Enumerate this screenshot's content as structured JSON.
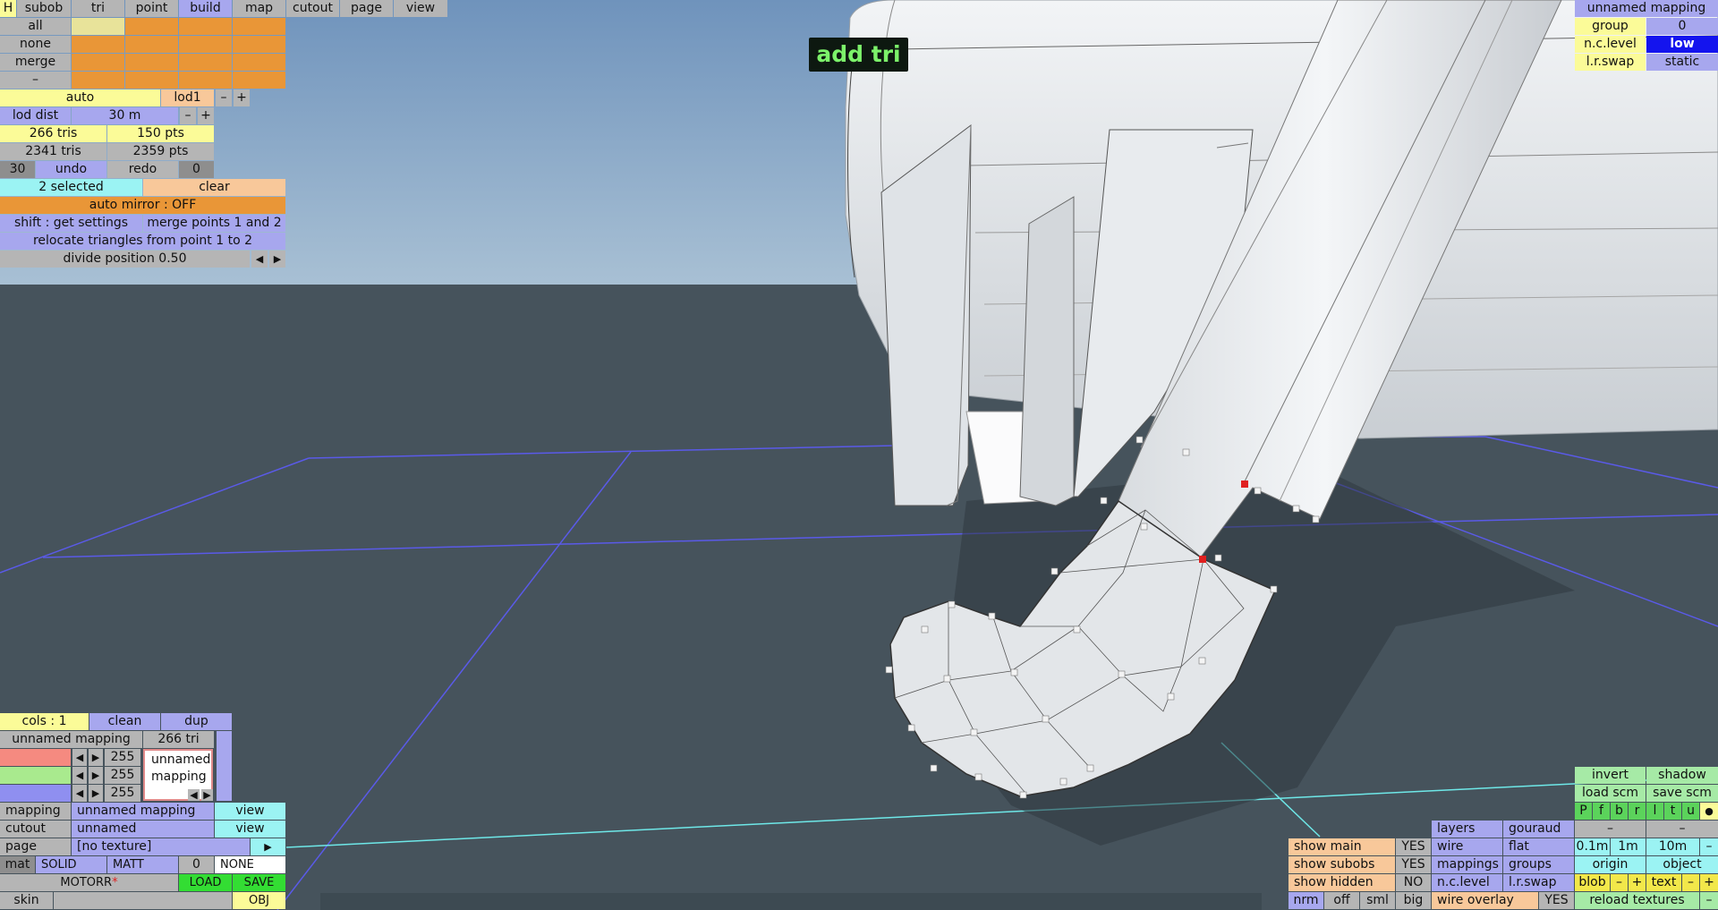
{
  "menu": {
    "h": "H",
    "tabs": [
      "subob",
      "tri",
      "point",
      "build",
      "map",
      "cutout",
      "page",
      "view"
    ],
    "active": "build"
  },
  "subob": {
    "all": "all",
    "none": "none",
    "merge": "merge",
    "minus": "–"
  },
  "lod": {
    "auto": "auto",
    "lod": "lod1",
    "minus": "–",
    "plus": "+",
    "dist_label": "lod dist",
    "dist_value": "30 m",
    "tris": "266 tris",
    "pts": "150 pts",
    "total_tris": "2341 tris",
    "total_pts": "2359 pts"
  },
  "history": {
    "count": "30",
    "undo": "undo",
    "redo": "redo",
    "redo_count": "0"
  },
  "selection": {
    "selected": "2 selected",
    "clear": "clear"
  },
  "build": {
    "auto_mirror": "auto mirror : OFF",
    "shift_settings": "shift : get settings",
    "merge_points": "merge points 1 and 2",
    "relocate": "relocate triangles from point 1 to 2",
    "divide": "divide position 0.50",
    "prev": "◀",
    "next": "▶"
  },
  "hint": "add tri",
  "mapping_panel": {
    "title": "unnamed mapping",
    "group_label": "group",
    "group_value": "0",
    "nclevel_label": "n.c.level",
    "nclevel_value": "low",
    "lrswap_label": "l.r.swap",
    "lrswap_value": "static"
  },
  "color_panel": {
    "cols": "cols : 1",
    "clean": "clean",
    "dup": "dup",
    "mapping": "unnamed mapping",
    "tri": "266 tri",
    "r": "255",
    "g": "255",
    "b": "255",
    "preview": "unnamed mapping",
    "left": "◀",
    "right": "▶"
  },
  "material": {
    "mapping_label": "mapping",
    "mapping_value": "unnamed mapping",
    "view": "view",
    "cutout_label": "cutout",
    "cutout_value": "unnamed",
    "page_label": "page",
    "page_value": "[no texture]",
    "page_arrow": "▶",
    "mat": "mat",
    "solid": "SOLID",
    "matt": "MATT",
    "num": "0",
    "none": "NONE",
    "name": "MOTORR",
    "star": "*",
    "load": "LOAD",
    "save": "SAVE",
    "skin": "skin",
    "obj": "OBJ"
  },
  "view_panel": {
    "invert": "invert",
    "shadow": "shadow",
    "load_scm": "load scm",
    "save_scm": "save scm",
    "letters": [
      "P",
      "f",
      "b",
      "r",
      "l",
      "t",
      "u"
    ],
    "dot": "●",
    "dash": "–",
    "layers": "layers",
    "gouraud": "gouraud",
    "show_main": "show main",
    "show_main_v": "YES",
    "wire": "wire",
    "flat": "flat",
    "g01": "0.1m",
    "g1": "1m",
    "g10": "10m",
    "show_subobs": "show subobs",
    "show_subobs_v": "YES",
    "mappings": "mappings",
    "groups": "groups",
    "origin": "origin",
    "object": "object",
    "show_hidden": "show hidden",
    "show_hidden_v": "NO",
    "nclevel": "n.c.level",
    "lrswap": "l.r.swap",
    "blob": "blob",
    "text": "text",
    "minus": "–",
    "plus": "+",
    "nrm": "nrm",
    "off": "off",
    "sml": "sml",
    "big": "big",
    "wire_overlay": "wire overlay",
    "wire_overlay_v": "YES",
    "reload": "reload textures"
  },
  "colors": {
    "sky": "#7d9fc4",
    "ground": "#46535c",
    "grid": "#5a5ae8",
    "model": "#e6e9ec",
    "selected_vertex": "#e02020",
    "hint_text": "#7cf26a"
  }
}
